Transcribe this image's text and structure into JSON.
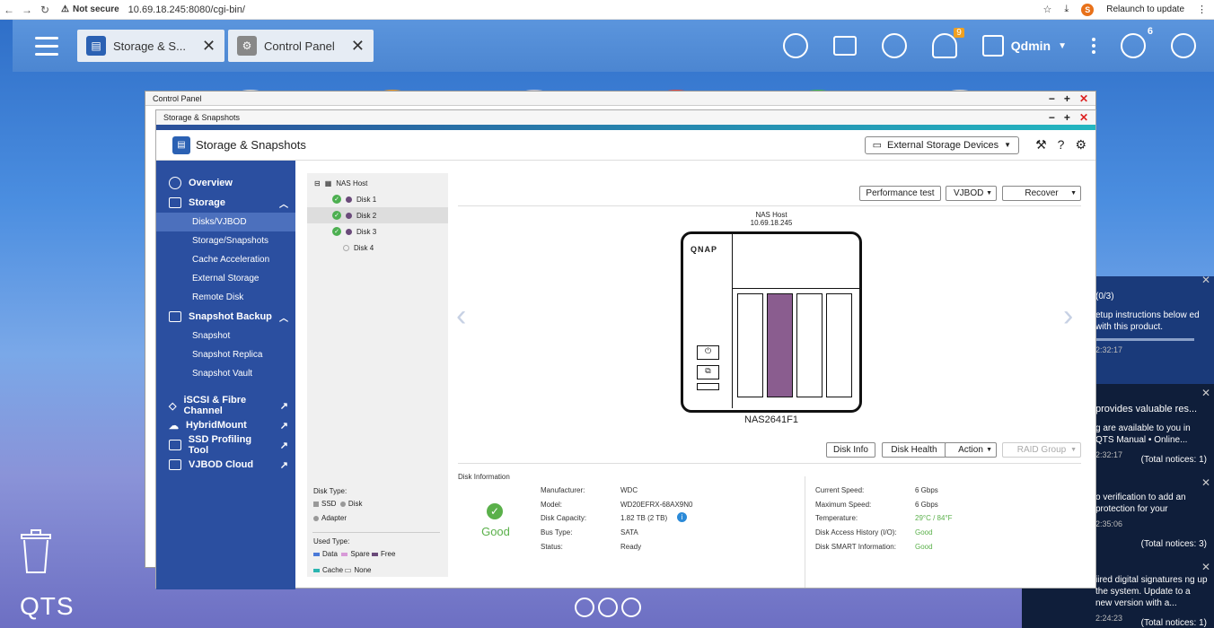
{
  "browser": {
    "security": "Not secure",
    "url": "10.69.18.245:8080/cgi-bin/",
    "profile_initial": "S",
    "relaunch": "Relaunch to update"
  },
  "topbar": {
    "tabs": [
      {
        "label": "Storage & S..."
      },
      {
        "label": "Control Panel"
      }
    ],
    "notification_count": "9",
    "info_count": "6",
    "user": "Qdmin"
  },
  "desktop": {
    "brand": "QTS"
  },
  "control_panel": {
    "title": "Control Panel"
  },
  "storage_window": {
    "title": "Storage & Snapshots",
    "header_title": "Storage & Snapshots",
    "external_devices": "External Storage Devices"
  },
  "sidebar": {
    "overview": "Overview",
    "storage": "Storage",
    "storage_items": [
      "Disks/VJBOD",
      "Storage/Snapshots",
      "Cache Acceleration",
      "External Storage",
      "Remote Disk"
    ],
    "snapshot_backup": "Snapshot Backup",
    "snapshot_items": [
      "Snapshot",
      "Snapshot Replica",
      "Snapshot Vault"
    ],
    "links": [
      "iSCSI & Fibre Channel",
      "HybridMount",
      "SSD Profiling Tool",
      "VJBOD Cloud"
    ]
  },
  "tree": {
    "root": "NAS Host",
    "disks": [
      "Disk 1",
      "Disk 2",
      "Disk 3",
      "Disk 4"
    ],
    "disk_type_label": "Disk Type:",
    "disk_types": [
      "SSD",
      "Disk",
      "Adapter"
    ],
    "used_type_label": "Used Type:",
    "used_types": [
      "Data",
      "Spare",
      "Free",
      "Cache",
      "None"
    ]
  },
  "toolbar": {
    "performance_test": "Performance test",
    "vjbod": "VJBOD",
    "recover": "Recover",
    "disk_info": "Disk Info",
    "disk_health": "Disk Health",
    "action": "Action",
    "raid_group": "RAID Group"
  },
  "nas": {
    "host_label": "NAS Host",
    "ip": "10.69.18.245",
    "brand": "QNAP",
    "model": "NAS2641F1"
  },
  "disk_info": {
    "section": "Disk Information",
    "status_word": "Good",
    "left": [
      {
        "label": "Manufacturer:",
        "value": "WDC"
      },
      {
        "label": "Model:",
        "value": "WD20EFRX-68AX9N0"
      },
      {
        "label": "Disk Capacity:",
        "value": "1.82 TB (2 TB)"
      },
      {
        "label": "Bus Type:",
        "value": "SATA"
      },
      {
        "label": "Status:",
        "value": "Ready"
      }
    ],
    "right": [
      {
        "label": "Current Speed:",
        "value": "6 Gbps"
      },
      {
        "label": "Maximum Speed:",
        "value": "6 Gbps"
      },
      {
        "label": "Temperature:",
        "value": "29°C / 84°F"
      },
      {
        "label": "Disk Access History (I/O):",
        "value": "Good"
      },
      {
        "label": "Disk SMART Information:",
        "value": "Good"
      }
    ]
  },
  "notifications": [
    {
      "head": "(0/3)",
      "body": "etup instructions below ed with this product.",
      "time": "2:32:17",
      "total": ""
    },
    {
      "head": "provides valuable res...",
      "body": "g are available to you in QTS Manual • Online...",
      "time": "2:32:17",
      "total": "(Total notices: 1)"
    },
    {
      "head": "",
      "body": "o verification to add an protection for your",
      "time": "2:35:06",
      "total": "(Total notices: 3)"
    },
    {
      "head": "",
      "body": "iired digital signatures ng up the system. Update to a new version with a...",
      "time": "2:24:23",
      "total": "(Total notices: 1)"
    }
  ]
}
